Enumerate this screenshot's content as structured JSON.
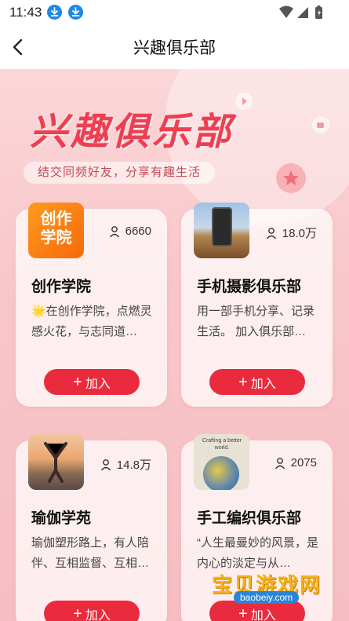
{
  "status_bar": {
    "time": "11:43",
    "icons": [
      "download-icon",
      "download-icon",
      "wifi-icon",
      "signal-icon",
      "battery-icon"
    ]
  },
  "header": {
    "title": "兴趣俱乐部",
    "back_icon": "chevron-left-icon"
  },
  "hero": {
    "title": "兴趣俱乐部",
    "subtitle": "结交同频好友，分享有趣生活"
  },
  "clubs": [
    {
      "name": "创作学院",
      "members": "6660",
      "desc": "🌟在创作学院，点燃灵感火花，与志同道…",
      "join_label": "加入",
      "thumb_text": "创作\n学院"
    },
    {
      "name": "手机摄影俱乐部",
      "members": "18.0万",
      "desc": "用一部手机分享、记录生活。 加入俱乐部…",
      "join_label": "加入"
    },
    {
      "name": "瑜伽学苑",
      "members": "14.8万",
      "desc": "瑜伽塑形路上，有人陪伴、互相监督、互相…",
      "join_label": "加入"
    },
    {
      "name": "手工编织俱乐部",
      "members": "2075",
      "desc": "“人生最曼妙的风景，是内心的淡定与从…",
      "join_label": "加入",
      "thumb_text": "Crafting a better world."
    }
  ],
  "watermark": {
    "text": "宝贝游戏网",
    "url": "baobeiy.com"
  },
  "colors": {
    "accent": "#e92b3d",
    "hero_title": "#ee3f52",
    "hero_bg": "#f8c6c9"
  }
}
